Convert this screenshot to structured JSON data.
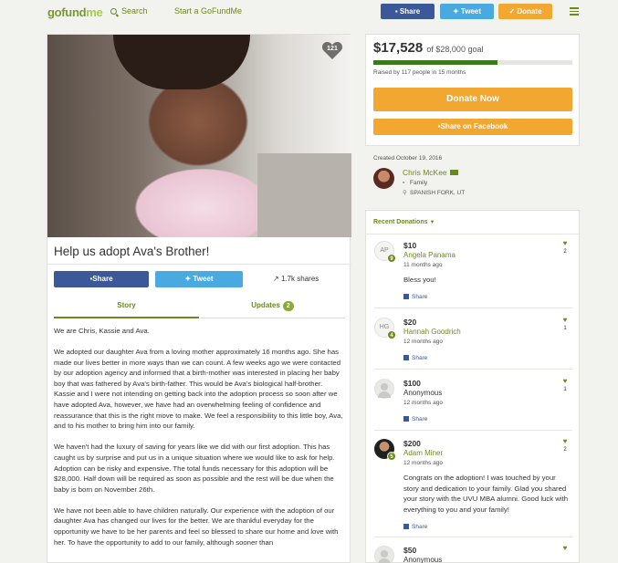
{
  "nav": {
    "logo_go": "gofund",
    "logo_me": "me",
    "search": "Search",
    "start": "Start a GoFundMe",
    "share": "Share",
    "tweet": "Tweet",
    "donate": "Donate"
  },
  "campaign": {
    "heart_count": "121",
    "title": "Help us adopt Ava's Brother!",
    "share_label": "Share",
    "tweet_label": "Tweet",
    "shares": "1.7k shares",
    "tab_story": "Story",
    "tab_updates": "Updates",
    "updates_count": "2",
    "story": [
      "We are Chris, Kassie and Ava.",
      "We adopted our daughter Ava from a loving mother approximately 16 months ago. She has made our lives better in more ways than we can count. A few weeks ago we were contacted by our adoption agency and informed that a birth-mother was interested in placing her baby boy that was fathered by Ava's  birth-father. This would be Ava's biological half-brother. Kassie and I were not intending on getting back into the adoption process so soon after we have adopted Ava, however, we have had an overwhelming feeling of confidence and reassurance that this is the right move to make. We feel a responsibility to this little boy, Ava, and to his mother to bring him into our family.",
      "We haven't had the luxury of saving for years like we did with our first adoption. This has caught us by surprise and put us in a unique situation where we would like to ask for help. Adoption can be risky and expensive. The total funds necessary for this adoption will be $28,000. Half down will be required as soon as possible and the rest will be due when the baby is born on November 26th.",
      "We have not been able to have children naturally. Our experience with the adoption of our daughter Ava has changed our lives for the better. We are thankful everyday for the opportunity we have to be her parents and feel so blessed to share our home and love with her. To have the opportunity to add to our family, although sooner than"
    ]
  },
  "goal": {
    "raised": "$17,528",
    "of_goal": "of $28,000 goal",
    "progress": 0.626,
    "raised_by": "Raised by 117 people in 15 months",
    "donate_now": "Donate Now",
    "share_facebook": "Share on Facebook"
  },
  "organizer": {
    "created": "Created October 19, 2016",
    "name": "Chris McKee",
    "category": "Family",
    "location": "SPANISH FORK, UT"
  },
  "donations": {
    "header": "Recent Donations",
    "share_label": "Share",
    "items": [
      {
        "initials": "AP",
        "badge": "9",
        "amount": "$10",
        "name": "Angela Panama",
        "time": "11 months ago",
        "message": "Bless you!",
        "likes": "2"
      },
      {
        "initials": "HG",
        "badge": "4",
        "amount": "$20",
        "name": "Hannah Goodrich",
        "time": "12 months ago",
        "message": "",
        "likes": "1"
      },
      {
        "initials": "",
        "badge": "",
        "amount": "$100",
        "name": "Anonymous",
        "time": "12 months ago",
        "message": "",
        "likes": "1"
      },
      {
        "initials": "",
        "badge": "5",
        "amount": "$200",
        "name": "Adam Miner",
        "time": "12 months ago",
        "message": "Congrats on the adoption! I was touched by your story and dedication to your family. Glad you shared your story with the UVU MBA alumni. Good luck with everything to you and your family!",
        "likes": "2"
      },
      {
        "initials": "",
        "badge": "",
        "amount": "$50",
        "name": "Anonymous",
        "time": "",
        "message": "",
        "likes": ""
      }
    ]
  },
  "colors": {
    "brand_green": "#6b8a1e",
    "facebook": "#3b5998",
    "twitter": "#4aa9e0",
    "donate_orange": "#f1a730",
    "progress": "#3d7a1e"
  }
}
